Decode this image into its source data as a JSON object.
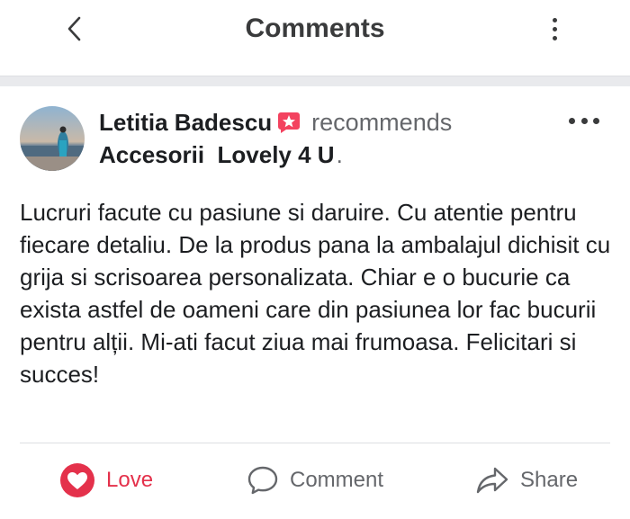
{
  "header": {
    "title": "Comments",
    "back_icon": "chevron-left-icon",
    "menu_icon": "vertical-dots-icon"
  },
  "post": {
    "author_name": "Letitia Badescu",
    "recommend_badge_icon": "star-badge-icon",
    "verb": "recommends",
    "page_name": "Accesorii  Lovely 4 U",
    "page_suffix": ".",
    "options_icon": "horizontal-dots-icon",
    "text": "Lucruri facute cu pasiune si daruire. Cu atentie pentru fiecare detaliu. De la produs pana la ambalajul dichisit cu grija si scrisoarea personalizata. Chiar e o bucurie ca exista astfel de oameni care din pasiunea lor fac bucurii pentru alții. Mi-ati facut ziua mai frumoasa. Felicitari si succes!"
  },
  "actions": {
    "love_label": "Love",
    "comment_label": "Comment",
    "share_label": "Share"
  },
  "colors": {
    "love": "#e4314b",
    "badge": "#f3425f",
    "secondary_text": "#65676b",
    "primary_text": "#1c1e21"
  }
}
